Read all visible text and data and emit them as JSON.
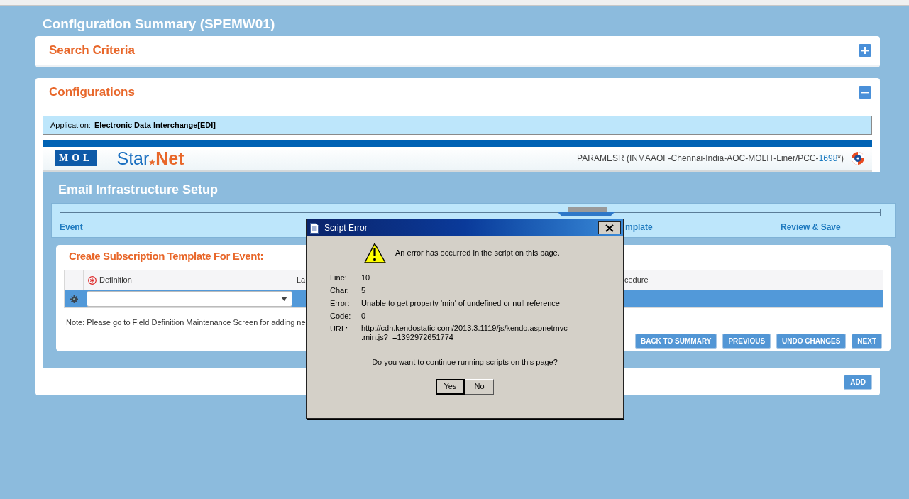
{
  "page_title": "Configuration Summary (SPEMW01)",
  "search_panel": {
    "title": "Search Criteria",
    "expanded": false
  },
  "config_panel": {
    "title": "Configurations",
    "expanded": true,
    "application": {
      "label": "Application:",
      "value": "Electronic Data Interchange[EDI]"
    },
    "brand": {
      "mol": "MOL",
      "name_left": "Star",
      "name_right": "Net"
    },
    "user": {
      "text": "PARAMESR (INMAAOF-Chennai-India-AOC-MOLIT-Liner/PCC-",
      "code": "1698",
      "suffix": "*)"
    },
    "setup": {
      "title": "Email Infrastructure Setup",
      "steps": [
        {
          "label": "Event"
        },
        {
          "label": "mplate"
        },
        {
          "label": "Review & Save"
        }
      ],
      "form": {
        "title": "Create Subscription Template For Event:",
        "columns": [
          {
            "label": "Definition",
            "required": true
          },
          {
            "label": "La",
            "required": false
          },
          {
            "label": "cedure",
            "required": false
          }
        ],
        "note": "Note: Please go to Field Definition Maintenance Screen for adding ne",
        "buttons": [
          "BACK TO SUMMARY",
          "PREVIOUS",
          "UNDO CHANGES",
          "NEXT"
        ]
      }
    },
    "add_button": "ADD"
  },
  "dialog": {
    "title": "Script Error",
    "message": "An error has occurred in the script on this page.",
    "details": [
      {
        "label": "Line:",
        "value": "10"
      },
      {
        "label": "Char:",
        "value": "5"
      },
      {
        "label": "Error:",
        "value": "Unable to get property 'min' of undefined or null reference"
      },
      {
        "label": "Code:",
        "value": "0"
      }
    ],
    "url": {
      "label": "URL:",
      "lines": [
        "http://cdn.kendostatic.com/2013.3.1119/js/kendo.aspnetmvc",
        ".min.js?_=1392972651774"
      ]
    },
    "question": "Do you want to continue running scripts on this page?",
    "buttons": [
      {
        "label": "Yes",
        "default": true
      },
      {
        "label": "No",
        "default": false
      }
    ]
  }
}
